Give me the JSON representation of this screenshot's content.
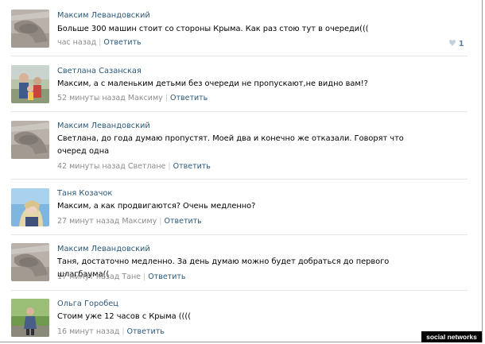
{
  "comments": [
    {
      "author": "Максим Левандовский",
      "text": "Больше 300 машин стоит со стороны Крыма. Как раз стою тут в очереди(((",
      "time": "час назад",
      "reply": "Ответить",
      "likes": "1"
    },
    {
      "author": "Светлана Сазанская",
      "text": "Максим, а с маленьким детьми без очереди не пропускают,не видно вам!?",
      "time": "52 минуты назад Максиму",
      "reply": "Ответить"
    },
    {
      "author": "Максим Левандовский",
      "text": "Светлана, до года думаю пропустят. Моей два и конечно же отказали. Говорят что очеред одна",
      "time": "42 минуты назад Светлане",
      "reply": "Ответить"
    },
    {
      "author": "Таня Козачок",
      "text": "Максим, а как продвигаются? Очень медленно?",
      "time": "27 минут назад Максиму",
      "reply": "Ответить"
    },
    {
      "author": "Максим Левандовский",
      "text": "Таня, достаточно медленно. За день думаю можно будет добраться до первого шлагбаума((",
      "time": "17 минут назад Тане",
      "reply": "Ответить"
    },
    {
      "author": "Ольга Горобец",
      "text": "Стоим уже 12 часов с Крыма ((((",
      "time": "16 минут назад",
      "reply": "Ответить"
    }
  ],
  "icons": {
    "like": "heart-icon"
  },
  "watermark": "social networks",
  "colors": {
    "link": "#2b587a",
    "meta": "#8c8c8c",
    "divider": "#e6e6e6"
  }
}
